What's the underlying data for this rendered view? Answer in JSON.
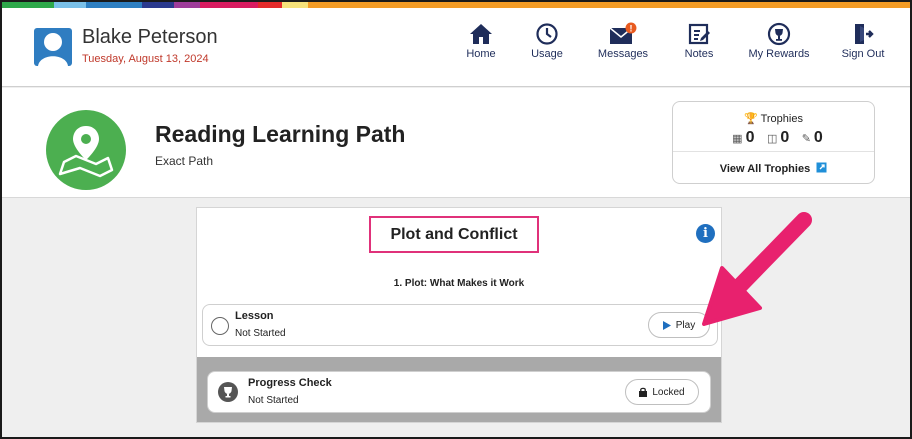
{
  "stripe_colors": [
    "#2ea84a",
    "#7ac0e8",
    "#2e7fc1",
    "#2b3a8e",
    "#9e3d9a",
    "#d81b60",
    "#e32a2a",
    "#f6e27a",
    "#f39c26"
  ],
  "user": {
    "name": "Blake Peterson",
    "date": "Tuesday, August 13, 2024"
  },
  "nav": [
    {
      "label": "Home",
      "icon": "home-icon"
    },
    {
      "label": "Usage",
      "icon": "clock-icon"
    },
    {
      "label": "Messages",
      "icon": "envelope-icon",
      "badge": "!"
    },
    {
      "label": "Notes",
      "icon": "notes-icon"
    },
    {
      "label": "My Rewards",
      "icon": "trophy-icon"
    },
    {
      "label": "Sign Out",
      "icon": "sign-out-icon"
    }
  ],
  "path": {
    "title": "Reading Learning Path",
    "subtitle": "Exact Path",
    "icon": "map-pin-icon",
    "color": "#4caf50"
  },
  "trophies": {
    "title": "Trophies",
    "counts": [
      {
        "icon": "calculator-icon",
        "value": "0"
      },
      {
        "icon": "book-icon",
        "value": "0"
      },
      {
        "icon": "pencil-icon",
        "value": "0"
      }
    ],
    "link_label": "View All Trophies"
  },
  "card": {
    "title": "Plot and Conflict",
    "subtitle": "1. Plot: What Makes it Work",
    "lesson": {
      "title": "Lesson",
      "status": "Not Started",
      "button": "Play"
    },
    "progress_check": {
      "title": "Progress Check",
      "status": "Not Started",
      "button": "Locked"
    }
  },
  "colors": {
    "accent_pink": "#e0317a",
    "nav_blue": "#1f2d5a",
    "date_red": "#c0392b",
    "info_blue": "#1f6fbf"
  }
}
